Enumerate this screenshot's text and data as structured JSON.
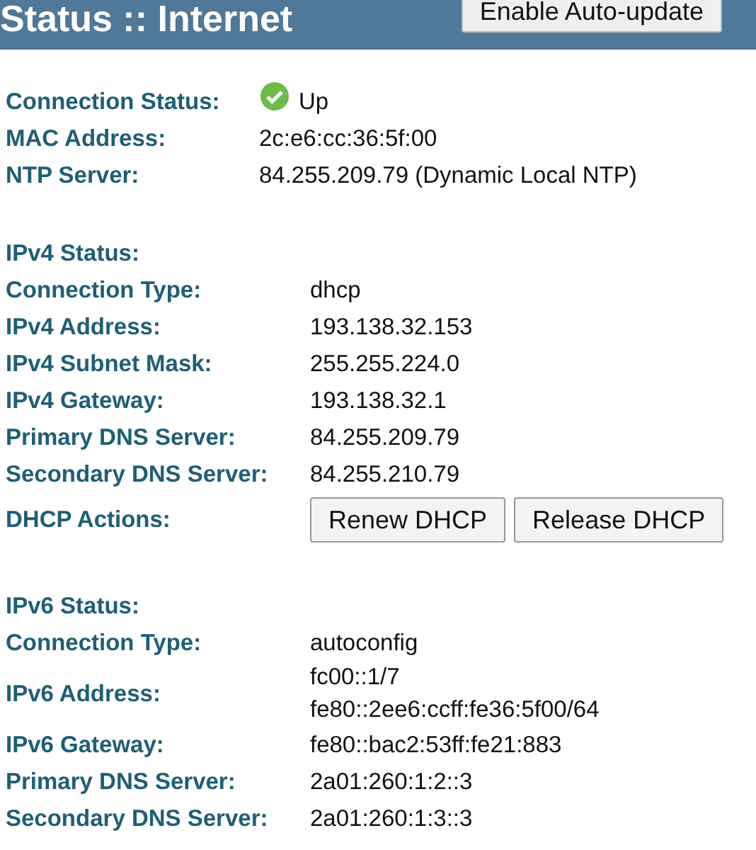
{
  "header": {
    "title": "Status :: Internet",
    "button": "Enable Auto-update"
  },
  "sections": [
    {
      "rows": [
        {
          "kind": "status",
          "label": "Connection Status:",
          "value": "Up",
          "ok": true
        },
        {
          "kind": "text",
          "label": "MAC Address:",
          "value": "2c:e6:cc:36:5f:00"
        },
        {
          "kind": "text",
          "label": "NTP Server:",
          "value": "84.255.209.79 (Dynamic Local NTP)"
        }
      ]
    },
    {
      "rows": [
        {
          "kind": "heading",
          "label": "IPv4 Status:"
        },
        {
          "kind": "text",
          "label": "Connection Type:",
          "value": "dhcp"
        },
        {
          "kind": "text",
          "label": "IPv4 Address:",
          "value": "193.138.32.153"
        },
        {
          "kind": "text",
          "label": "IPv4 Subnet Mask:",
          "value": "255.255.224.0"
        },
        {
          "kind": "text",
          "label": "IPv4 Gateway:",
          "value": "193.138.32.1"
        },
        {
          "kind": "text",
          "label": "Primary DNS Server:",
          "value": "84.255.209.79"
        },
        {
          "kind": "text",
          "label": "Secondary DNS Server:",
          "value": "84.255.210.79"
        },
        {
          "kind": "buttons",
          "label": "DHCP Actions:",
          "buttons": [
            "Renew DHCP",
            "Release DHCP"
          ]
        }
      ]
    },
    {
      "rows": [
        {
          "kind": "heading",
          "label": "IPv6 Status:"
        },
        {
          "kind": "text",
          "label": "Connection Type:",
          "value": "autoconfig"
        },
        {
          "kind": "lines",
          "label": "IPv6 Address:",
          "lines": [
            "fc00::1/7",
            "fe80::2ee6:ccff:fe36:5f00/64"
          ]
        },
        {
          "kind": "text",
          "label": "IPv6 Gateway:",
          "value": "fe80::bac2:53ff:fe21:883"
        },
        {
          "kind": "text",
          "label": "Primary DNS Server:",
          "value": "2a01:260:1:2::3"
        },
        {
          "kind": "text",
          "label": "Secondary DNS Server:",
          "value": "2a01:260:1:3::3"
        }
      ]
    }
  ]
}
